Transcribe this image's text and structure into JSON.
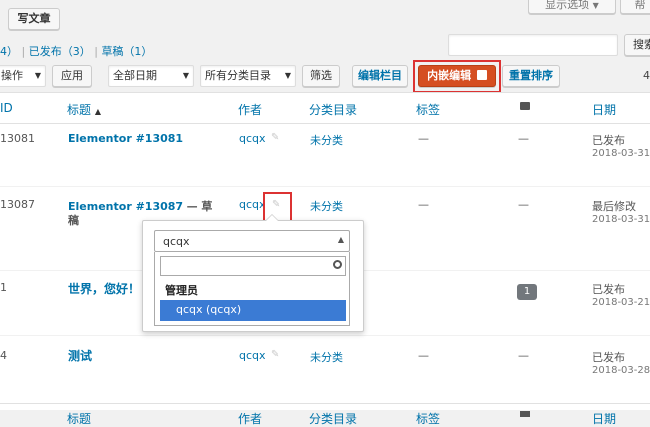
{
  "header": {
    "write_article": "写文章",
    "screen_options": "显示选项",
    "help_partial": "帮"
  },
  "filters": {
    "count_prefix": "4）",
    "published": "已发布（3）",
    "drafts": "草稿（1）",
    "sep": "|"
  },
  "search": {
    "value": "",
    "button": "搜索"
  },
  "toolbar": {
    "bulk_action": "操作",
    "apply": "应用",
    "all_dates": "全部日期",
    "all_categories": "所有分类目录",
    "filter": "筛选",
    "edit_columns": "编辑栏目",
    "inline_edit": "内嵌编辑",
    "reset_order": "重置排序",
    "item_count_partial": "4"
  },
  "columns": {
    "id": "ID",
    "title": "标题",
    "sort_indicator": "▲",
    "author": "作者",
    "categories": "分类目录",
    "tags": "标签",
    "date": "日期"
  },
  "rows": [
    {
      "id": "13081",
      "title": "Elementor #13081",
      "title_suffix": "",
      "author": "qcqx",
      "category": "未分类",
      "tags": "—",
      "comments": "—",
      "status": "已发布",
      "date": "2018-03-31"
    },
    {
      "id": "13087",
      "title": "Elementor #13087",
      "title_suffix": "— 草",
      "title_suffix2": "稿",
      "author": "qcqx",
      "category": "未分类",
      "tags": "—",
      "comments": "—",
      "status": "最后修改",
      "date": "2018-03-31"
    },
    {
      "id": "1",
      "title": "世界，您好！",
      "title_suffix": "",
      "author": "",
      "category": "",
      "tags": "",
      "comments": "1",
      "status": "已发布",
      "date": "2018-03-21"
    },
    {
      "id": "4",
      "title": "测试",
      "title_suffix": "",
      "author": "qcqx",
      "category": "未分类",
      "tags": "—",
      "comments": "—",
      "status": "已发布",
      "date": "2018-03-28"
    }
  ],
  "footer_columns": {
    "title": "标题",
    "author": "作者",
    "categories": "分类目录",
    "tags": "标签",
    "date": "日期"
  },
  "dropdown": {
    "selected": "qcqx",
    "search_value": "",
    "group_label": "管理员",
    "option": "qcqx (qcqx)"
  },
  "colors": {
    "accent": "#0073aa",
    "highlight": "#dc3232",
    "inline_btn": "#d54e21",
    "option_bg": "#3b7bd4"
  }
}
